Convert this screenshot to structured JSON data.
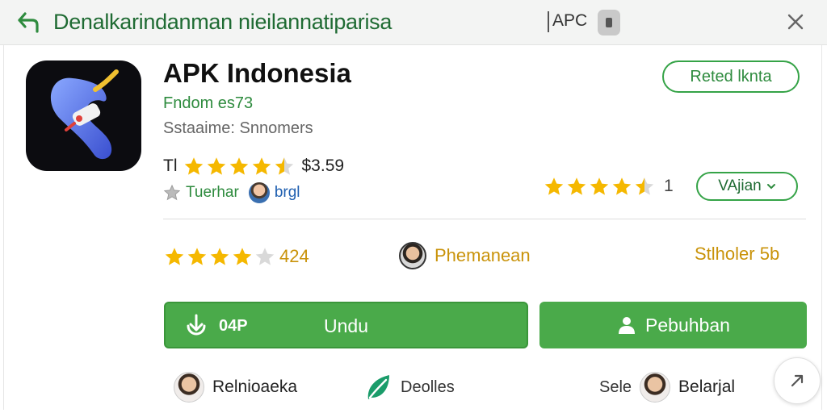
{
  "header": {
    "title": "Denalkarindanman nieilannatiparisa",
    "tag": "APC",
    "back_icon": "back-arrow-icon",
    "close_icon": "close-icon"
  },
  "app": {
    "name": "APK Indonesia",
    "developer": "Fndom es73",
    "category": "Sstaaime: Snnomers",
    "rating_prefix": "Tl",
    "rating_stars": 4.5,
    "price": "$3.59",
    "tag_label": "Tuerhar",
    "tag_user": "brgl",
    "icon": "app-logo-icon"
  },
  "actions": {
    "rated_button": "Reted lknta",
    "version_select": "VAjian",
    "right_rating_stars": 4.5,
    "right_rating_count": "1"
  },
  "stats": {
    "rating_stars": 4,
    "rating_value": "424",
    "middle_label": "Phemanean",
    "right_label": "Stlholer 5b"
  },
  "buttons": {
    "primary_size": "04P",
    "primary_label": "Undu",
    "secondary_label": "Pebuhban"
  },
  "bottom": {
    "item1": "Relnioaeka",
    "item2": "Deolles",
    "item3_prefix": "Sele",
    "item3": "Belarjal"
  },
  "colors": {
    "accent": "#4aaa4a",
    "accent_text": "#2e8b3e",
    "star": "#f5b800",
    "stat_text": "#c9930a"
  }
}
